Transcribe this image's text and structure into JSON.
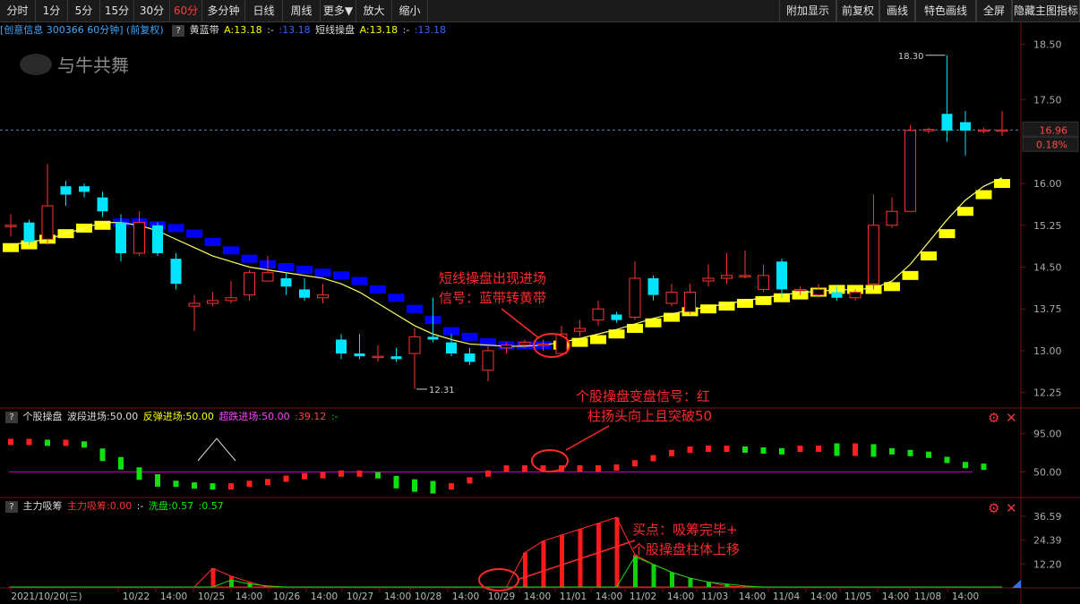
{
  "toolbar": {
    "left": [
      "分时",
      "1分",
      "5分",
      "15分",
      "30分",
      "60分",
      "多分钟",
      "日线",
      "周线",
      "更多▼",
      "放大",
      "缩小"
    ],
    "active": "60分",
    "right": [
      "附加显示",
      "前复权",
      "画线",
      "特色画线",
      "全屏",
      "隐藏主图指标"
    ]
  },
  "main_header": {
    "stock": "[创意信息 300366 60分钟] (前复权)",
    "ind1_name": "黄蓝带",
    "ind1_a": "A:13.18",
    "ind1_b": ":-",
    "ind1_c": ":13.18",
    "ind2_name": "短线操盘",
    "ind2_a": "A:13.18",
    "ind2_b": ":-",
    "ind2_c": ":13.18"
  },
  "watermark": "与牛共舞",
  "colors": {
    "up": "#ff3333",
    "down": "#00e5ff",
    "yellow": "#ffff00",
    "blue": "#0000ff",
    "green": "#00cc00",
    "magenta": "#cc00cc"
  },
  "chart_data": [
    {
      "type": "candlestick",
      "name": "60分钟K线",
      "ylim": [
        12.1,
        18.65
      ],
      "yticks": [
        "18.50",
        "17.50",
        "16.00",
        "15.25",
        "14.50",
        "13.75",
        "13.00",
        "12.25"
      ],
      "ytick_values": [
        18.5,
        17.5,
        16.0,
        15.25,
        14.5,
        13.75,
        13.0,
        12.25
      ],
      "last_price_label": "16.96",
      "last_price": 16.96,
      "change_label": "0.18%",
      "high_label": "18.30",
      "high_value": 18.3,
      "low_label": "12.31",
      "low_value": 12.31,
      "candles": [
        {
          "o": 15.25,
          "c": 15.25,
          "h": 15.45,
          "l": 15.05
        },
        {
          "o": 15.3,
          "c": 14.95,
          "h": 15.35,
          "l": 14.9
        },
        {
          "o": 15.0,
          "c": 15.6,
          "h": 16.35,
          "l": 14.9
        },
        {
          "o": 15.95,
          "c": 15.8,
          "h": 16.05,
          "l": 15.6
        },
        {
          "o": 15.95,
          "c": 15.85,
          "h": 16.0,
          "l": 15.75
        },
        {
          "o": 15.75,
          "c": 15.5,
          "h": 15.85,
          "l": 15.4
        },
        {
          "o": 15.3,
          "c": 14.75,
          "h": 15.45,
          "l": 14.6
        },
        {
          "o": 14.75,
          "c": 15.3,
          "h": 15.5,
          "l": 14.7
        },
        {
          "o": 15.25,
          "c": 14.75,
          "h": 15.3,
          "l": 14.7
        },
        {
          "o": 14.65,
          "c": 14.2,
          "h": 14.75,
          "l": 14.1
        },
        {
          "o": 13.8,
          "c": 13.85,
          "h": 14.0,
          "l": 13.35
        },
        {
          "o": 13.85,
          "c": 13.9,
          "h": 14.05,
          "l": 13.8
        },
        {
          "o": 13.9,
          "c": 13.95,
          "h": 14.25,
          "l": 13.85
        },
        {
          "o": 14.0,
          "c": 14.4,
          "h": 14.45,
          "l": 13.9
        },
        {
          "o": 14.25,
          "c": 14.4,
          "h": 14.7,
          "l": 14.25
        },
        {
          "o": 14.3,
          "c": 14.15,
          "h": 14.4,
          "l": 14.0
        },
        {
          "o": 14.1,
          "c": 13.95,
          "h": 14.3,
          "l": 13.9
        },
        {
          "o": 13.95,
          "c": 14.0,
          "h": 14.2,
          "l": 13.85
        },
        {
          "o": 13.2,
          "c": 12.95,
          "h": 13.3,
          "l": 12.85
        },
        {
          "o": 12.95,
          "c": 12.9,
          "h": 13.3,
          "l": 12.85
        },
        {
          "o": 12.9,
          "c": 12.9,
          "h": 13.1,
          "l": 12.8
        },
        {
          "o": 12.9,
          "c": 12.85,
          "h": 13.05,
          "l": 12.8
        },
        {
          "o": 12.95,
          "c": 13.25,
          "h": 13.4,
          "l": 12.31
        },
        {
          "o": 13.25,
          "c": 13.2,
          "h": 13.95,
          "l": 13.15
        },
        {
          "o": 13.15,
          "c": 12.95,
          "h": 13.3,
          "l": 12.9
        },
        {
          "o": 12.95,
          "c": 12.8,
          "h": 13.05,
          "l": 12.75
        },
        {
          "o": 12.65,
          "c": 13.0,
          "h": 13.1,
          "l": 12.45
        },
        {
          "o": 13.05,
          "c": 13.1,
          "h": 13.15,
          "l": 12.95
        },
        {
          "o": 13.1,
          "c": 13.15,
          "h": 13.2,
          "l": 13.05
        },
        {
          "o": 13.1,
          "c": 13.12,
          "h": 13.2,
          "l": 13.0
        },
        {
          "o": 12.95,
          "c": 13.3,
          "h": 13.45,
          "l": 12.9
        },
        {
          "o": 13.35,
          "c": 13.4,
          "h": 13.55,
          "l": 13.25
        },
        {
          "o": 13.55,
          "c": 13.75,
          "h": 13.9,
          "l": 13.45
        },
        {
          "o": 13.65,
          "c": 13.55,
          "h": 13.7,
          "l": 13.5
        },
        {
          "o": 13.6,
          "c": 14.3,
          "h": 14.6,
          "l": 13.55
        },
        {
          "o": 14.3,
          "c": 14.0,
          "h": 14.35,
          "l": 13.9
        },
        {
          "o": 13.85,
          "c": 14.05,
          "h": 14.2,
          "l": 13.8
        },
        {
          "o": 13.7,
          "c": 14.05,
          "h": 14.2,
          "l": 13.65
        },
        {
          "o": 14.25,
          "c": 14.3,
          "h": 14.55,
          "l": 14.15
        },
        {
          "o": 14.3,
          "c": 14.35,
          "h": 14.75,
          "l": 14.2
        },
        {
          "o": 14.35,
          "c": 14.35,
          "h": 14.8,
          "l": 14.3
        },
        {
          "o": 14.1,
          "c": 14.35,
          "h": 14.55,
          "l": 14.05
        },
        {
          "o": 14.6,
          "c": 14.1,
          "h": 14.65,
          "l": 13.95
        },
        {
          "o": 14.1,
          "c": 14.1,
          "h": 14.15,
          "l": 14.0
        },
        {
          "o": 14.0,
          "c": 14.1,
          "h": 14.2,
          "l": 13.95
        },
        {
          "o": 14.05,
          "c": 13.95,
          "h": 14.15,
          "l": 13.9
        },
        {
          "o": 13.95,
          "c": 14.05,
          "h": 14.1,
          "l": 13.9
        },
        {
          "o": 14.2,
          "c": 15.25,
          "h": 15.8,
          "l": 14.1
        },
        {
          "o": 15.25,
          "c": 15.5,
          "h": 15.75,
          "l": 15.2
        },
        {
          "o": 15.5,
          "c": 16.95,
          "h": 17.05,
          "l": 15.5
        },
        {
          "o": 16.95,
          "c": 16.97,
          "h": 17.0,
          "l": 16.9
        },
        {
          "o": 17.25,
          "c": 16.95,
          "h": 18.3,
          "l": 16.75
        },
        {
          "o": 17.1,
          "c": 16.95,
          "h": 17.3,
          "l": 16.5
        },
        {
          "o": 16.95,
          "c": 16.96,
          "h": 17.0,
          "l": 16.9
        },
        {
          "o": 16.96,
          "c": 16.96,
          "h": 17.3,
          "l": 16.85
        }
      ],
      "band_values": [
        14.85,
        14.9,
        15.0,
        15.1,
        15.2,
        15.25,
        15.3,
        15.3,
        15.25,
        15.2,
        15.1,
        14.95,
        14.8,
        14.65,
        14.55,
        14.5,
        14.45,
        14.4,
        14.35,
        14.25,
        14.1,
        13.95,
        13.75,
        13.55,
        13.35,
        13.25,
        13.15,
        13.1,
        13.1,
        13.1,
        13.1,
        13.15,
        13.2,
        13.3,
        13.4,
        13.5,
        13.6,
        13.7,
        13.75,
        13.8,
        13.85,
        13.9,
        13.95,
        14.0,
        14.05,
        14.1,
        14.1,
        14.1,
        14.15,
        14.35,
        14.7,
        15.1,
        15.5,
        15.8,
        16.0,
        16.15
      ],
      "band_color": [
        "yellow",
        "yellow",
        "yellow",
        "yellow",
        "yellow",
        "yellow",
        "blue",
        "blue",
        "blue",
        "blue",
        "blue",
        "blue",
        "blue",
        "blue",
        "blue",
        "blue",
        "blue",
        "blue",
        "blue",
        "blue",
        "blue",
        "blue",
        "blue",
        "blue",
        "blue",
        "blue",
        "blue",
        "blue",
        "blue",
        "blue",
        "yellow",
        "yellow",
        "yellow",
        "yellow",
        "yellow",
        "yellow",
        "yellow",
        "yellow",
        "yellow",
        "yellow",
        "yellow",
        "yellow",
        "yellow",
        "yellow",
        "yellow",
        "yellow",
        "yellow",
        "yellow",
        "yellow",
        "yellow",
        "yellow",
        "yellow",
        "yellow",
        "yellow",
        "yellow"
      ],
      "band_line": [
        14.9,
        14.95,
        15.0,
        15.1,
        15.2,
        15.3,
        15.3,
        15.25,
        15.15,
        15.0,
        14.85,
        14.7,
        14.6,
        14.5,
        14.45,
        14.4,
        14.35,
        14.3,
        14.2,
        14.05,
        13.85,
        13.65,
        13.45,
        13.3,
        13.2,
        13.12,
        13.1,
        13.08,
        13.08,
        13.1,
        13.15,
        13.22,
        13.3,
        13.38,
        13.48,
        13.58,
        13.66,
        13.73,
        13.79,
        13.84,
        13.9,
        13.95,
        14.0,
        14.04,
        14.07,
        14.09,
        14.1,
        14.12,
        14.25,
        14.55,
        14.95,
        15.35,
        15.7,
        15.95,
        16.1
      ]
    },
    {
      "type": "scatter",
      "name": "个股操盘",
      "ylim": [
        20,
        110
      ],
      "yticks": [
        "95.00",
        "50.00"
      ],
      "ytick_values": [
        95,
        50
      ],
      "level": 50,
      "values": [
        85,
        85,
        84,
        84,
        82,
        70,
        60,
        48,
        40,
        36,
        34,
        33,
        33,
        36,
        38,
        42,
        45,
        46,
        48,
        48,
        46,
        38,
        34,
        32,
        33,
        40,
        48,
        54,
        54,
        54,
        54,
        54,
        54,
        55,
        60,
        66,
        72,
        76,
        77,
        77,
        76,
        75,
        74,
        77,
        77,
        76,
        76,
        75,
        74,
        72,
        70,
        64,
        58,
        56,
        55,
        54,
        60,
        78,
        88,
        92,
        92,
        86,
        82,
        78
      ]
    },
    {
      "type": "bar",
      "name": "主力吸筹",
      "ylim": [
        0,
        40
      ],
      "yticks": [
        "36.59",
        "24.39",
        "12.20"
      ],
      "ytick_values": [
        36.59,
        24.39,
        12.2
      ],
      "bars": [
        0,
        0,
        0,
        0,
        0,
        0,
        0,
        0,
        0,
        0,
        0,
        10,
        0,
        0,
        0,
        0,
        0,
        0,
        0,
        0,
        0,
        0,
        0,
        0,
        0,
        0,
        0,
        0,
        0,
        0,
        0,
        0,
        0,
        0,
        0,
        0,
        0,
        0,
        0,
        0,
        0,
        0,
        0,
        0,
        0,
        0,
        0,
        0,
        0,
        0,
        0,
        0,
        0,
        0,
        0,
        0,
        0,
        0,
        0,
        0,
        0,
        0,
        0,
        0,
        0
      ],
      "red_bars": [
        0,
        0,
        0,
        0,
        0,
        0,
        0,
        0,
        0,
        0,
        0,
        10,
        6,
        3,
        0,
        0,
        0,
        0,
        0,
        0,
        0,
        0,
        0,
        0,
        0,
        0,
        0,
        0,
        18,
        24,
        27,
        30,
        33,
        36,
        17,
        12,
        8,
        5,
        3,
        1,
        0,
        0,
        0,
        0,
        0,
        0,
        0,
        0,
        0,
        0,
        0,
        0,
        0,
        0,
        0,
        0,
        0,
        0,
        0,
        0,
        0,
        0,
        0,
        0,
        0
      ],
      "green_line": [
        0,
        0,
        0,
        0,
        0,
        0,
        0,
        0,
        0,
        0,
        0,
        0,
        4,
        2,
        1,
        0,
        0,
        0,
        0,
        0,
        0,
        0,
        0,
        0,
        0,
        0,
        0,
        0,
        0,
        0,
        0,
        0,
        0,
        0,
        16,
        12,
        8,
        5,
        3,
        2,
        1,
        0,
        0,
        0,
        0,
        0,
        0,
        0,
        0,
        0,
        0,
        0,
        0,
        0,
        0,
        0,
        0,
        0,
        0,
        0,
        0,
        0,
        0,
        0,
        0
      ]
    }
  ],
  "panel2_header": {
    "title": "个股操盘",
    "a": "波段进场:50.00",
    "b": "反弹进场:50.00",
    "c": "超跌进场:50.00",
    "d": ":39.12",
    "e": ":-"
  },
  "panel3_header": {
    "title": "主力吸筹",
    "a": "主力吸筹:0.00",
    "b": ":-",
    "c": "洗盘:0.57",
    "d": ":0.57"
  },
  "xaxis": {
    "labels": [
      "2021/10/20(三)",
      "10/22",
      "14:00",
      "10/25",
      "14:00",
      "10/26",
      "14:00",
      "10/27",
      "14:00",
      "10/28",
      "14:00",
      "10/29",
      "14:00",
      "11/01",
      "14:00",
      "11/02",
      "14:00",
      "11/03",
      "14:00",
      "11/04",
      "14:00",
      "11/05",
      "14:00",
      "11/08",
      "14:00"
    ]
  },
  "annotations": {
    "a1_line1": "短线操盘出现进场",
    "a1_line2": "信号：蓝带转黄带",
    "a2_line1": "个股操盘变盘信号：红",
    "a2_line2": "柱扬头向上且突破50",
    "a3_line1": "买点：吸筹完毕+",
    "a3_line2": "个股操盘柱体上移"
  }
}
